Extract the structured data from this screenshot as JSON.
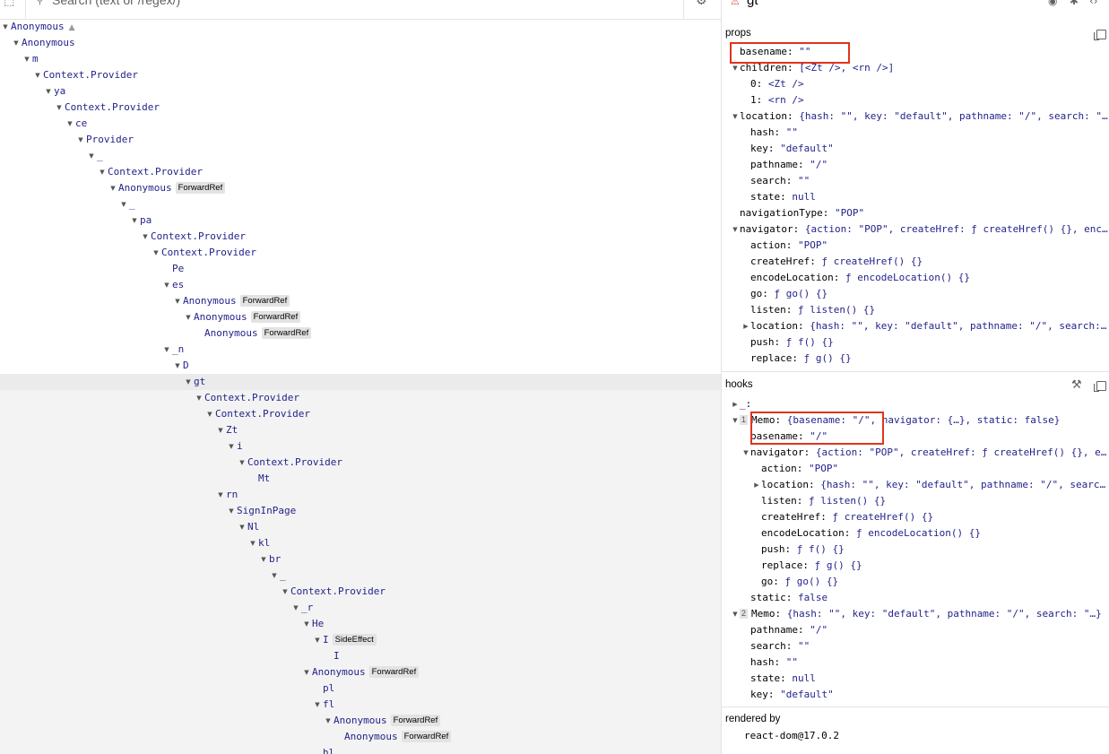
{
  "toolbar": {
    "search_placeholder": "Search (text or /regex/)"
  },
  "tree": [
    {
      "name": "Anonymous",
      "depth": 0,
      "warn": true
    },
    {
      "name": "Anonymous",
      "depth": 1
    },
    {
      "name": "m",
      "depth": 2
    },
    {
      "name": "Context.Provider",
      "depth": 3
    },
    {
      "name": "ya",
      "depth": 4
    },
    {
      "name": "Context.Provider",
      "depth": 5
    },
    {
      "name": "ce",
      "depth": 6
    },
    {
      "name": "Provider",
      "depth": 7
    },
    {
      "name": "_",
      "depth": 8
    },
    {
      "name": "Context.Provider",
      "depth": 9
    },
    {
      "name": "Anonymous",
      "depth": 10,
      "badge": "ForwardRef"
    },
    {
      "name": "_",
      "depth": 11
    },
    {
      "name": "pa",
      "depth": 12
    },
    {
      "name": "Context.Provider",
      "depth": 13
    },
    {
      "name": "Context.Provider",
      "depth": 14
    },
    {
      "name": "Pe",
      "depth": 15,
      "leaf": true
    },
    {
      "name": "es",
      "depth": 15
    },
    {
      "name": "Anonymous",
      "depth": 16,
      "badge": "ForwardRef"
    },
    {
      "name": "Anonymous",
      "depth": 17,
      "badge": "ForwardRef"
    },
    {
      "name": "Anonymous",
      "depth": 18,
      "badge": "ForwardRef",
      "leaf": true
    },
    {
      "name": "_n",
      "depth": 15
    },
    {
      "name": "D",
      "depth": 16
    },
    {
      "name": "gt",
      "depth": 17,
      "selected": true
    },
    {
      "name": "Context.Provider",
      "depth": 18
    },
    {
      "name": "Context.Provider",
      "depth": 19
    },
    {
      "name": "Zt",
      "depth": 20
    },
    {
      "name": "i",
      "depth": 21
    },
    {
      "name": "Context.Provider",
      "depth": 22
    },
    {
      "name": "Mt",
      "depth": 23,
      "leaf": true
    },
    {
      "name": "rn",
      "depth": 20
    },
    {
      "name": "SignInPage",
      "depth": 21
    },
    {
      "name": "Nl",
      "depth": 22
    },
    {
      "name": "kl",
      "depth": 23
    },
    {
      "name": "br",
      "depth": 24
    },
    {
      "name": "_",
      "depth": 25
    },
    {
      "name": "Context.Provider",
      "depth": 26
    },
    {
      "name": "_r",
      "depth": 27
    },
    {
      "name": "He",
      "depth": 28
    },
    {
      "name": "I",
      "depth": 29,
      "badge": "SideEffect"
    },
    {
      "name": "I",
      "depth": 30,
      "leaf": true
    },
    {
      "name": "Anonymous",
      "depth": 28,
      "badge": "ForwardRef"
    },
    {
      "name": "pl",
      "depth": 29,
      "leaf": true
    },
    {
      "name": "fl",
      "depth": 29
    },
    {
      "name": "Anonymous",
      "depth": 30,
      "badge": "ForwardRef"
    },
    {
      "name": "Anonymous",
      "depth": 31,
      "badge": "ForwardRef",
      "leaf": true
    },
    {
      "name": "hl",
      "depth": 29,
      "leaf": true
    }
  ],
  "inspector": {
    "component_name": "gt",
    "props_title": "props",
    "hooks_title": "hooks",
    "rendered_by_title": "rendered by",
    "rendered_by_value": "react-dom@17.0.2",
    "props": [
      {
        "indent": 0,
        "arrow": "none",
        "key": "basename",
        "value": "\"\""
      },
      {
        "indent": 0,
        "arrow": "down",
        "key": "children",
        "value": "[<Zt />, <rn />]"
      },
      {
        "indent": 1,
        "arrow": "none",
        "key": "0",
        "value": "<Zt />"
      },
      {
        "indent": 1,
        "arrow": "none",
        "key": "1",
        "value": "<rn />"
      },
      {
        "indent": 0,
        "arrow": "down",
        "key": "location",
        "value": "{hash: \"\", key: \"default\", pathname: \"/\", search: \"…"
      },
      {
        "indent": 1,
        "arrow": "none",
        "key": "hash",
        "value": "\"\""
      },
      {
        "indent": 1,
        "arrow": "none",
        "key": "key",
        "value": "\"default\""
      },
      {
        "indent": 1,
        "arrow": "none",
        "key": "pathname",
        "value": "\"/\""
      },
      {
        "indent": 1,
        "arrow": "none",
        "key": "search",
        "value": "\"\""
      },
      {
        "indent": 1,
        "arrow": "none",
        "key": "state",
        "value": "null"
      },
      {
        "indent": 0,
        "arrow": "none",
        "key": "navigationType",
        "value": "\"POP\""
      },
      {
        "indent": 0,
        "arrow": "down",
        "key": "navigator",
        "value": "{action: \"POP\", createHref: ƒ createHref() {}, enc…"
      },
      {
        "indent": 1,
        "arrow": "none",
        "key": "action",
        "value": "\"POP\""
      },
      {
        "indent": 1,
        "arrow": "none",
        "key": "createHref",
        "value": "ƒ createHref() {}"
      },
      {
        "indent": 1,
        "arrow": "none",
        "key": "encodeLocation",
        "value": "ƒ encodeLocation() {}"
      },
      {
        "indent": 1,
        "arrow": "none",
        "key": "go",
        "value": "ƒ go() {}"
      },
      {
        "indent": 1,
        "arrow": "none",
        "key": "listen",
        "value": "ƒ listen() {}"
      },
      {
        "indent": 1,
        "arrow": "right",
        "key": "location",
        "value": "{hash: \"\", key: \"default\", pathname: \"/\", search:…"
      },
      {
        "indent": 1,
        "arrow": "none",
        "key": "push",
        "value": "ƒ f() {}"
      },
      {
        "indent": 1,
        "arrow": "none",
        "key": "replace",
        "value": "ƒ g() {}"
      }
    ],
    "hooks": [
      {
        "indent": 0,
        "arrow": "right",
        "num": "",
        "key": "_",
        "value": ""
      },
      {
        "indent": 0,
        "arrow": "down",
        "num": "1",
        "key": "Memo",
        "value": "{basename: \"/\", navigator: {…}, static: false}"
      },
      {
        "indent": 1,
        "arrow": "none",
        "num": "",
        "key": "basename",
        "value": "\"/\""
      },
      {
        "indent": 1,
        "arrow": "down",
        "num": "",
        "key": "navigator",
        "value": "{action: \"POP\", createHref: ƒ createHref() {}, e…"
      },
      {
        "indent": 2,
        "arrow": "none",
        "num": "",
        "key": "action",
        "value": "\"POP\""
      },
      {
        "indent": 2,
        "arrow": "right",
        "num": "",
        "key": "location",
        "value": "{hash: \"\", key: \"default\", pathname: \"/\", searc…"
      },
      {
        "indent": 2,
        "arrow": "none",
        "num": "",
        "key": "listen",
        "value": "ƒ listen() {}"
      },
      {
        "indent": 2,
        "arrow": "none",
        "num": "",
        "key": "createHref",
        "value": "ƒ createHref() {}"
      },
      {
        "indent": 2,
        "arrow": "none",
        "num": "",
        "key": "encodeLocation",
        "value": "ƒ encodeLocation() {}"
      },
      {
        "indent": 2,
        "arrow": "none",
        "num": "",
        "key": "push",
        "value": "ƒ f() {}"
      },
      {
        "indent": 2,
        "arrow": "none",
        "num": "",
        "key": "replace",
        "value": "ƒ g() {}"
      },
      {
        "indent": 2,
        "arrow": "none",
        "num": "",
        "key": "go",
        "value": "ƒ go() {}"
      },
      {
        "indent": 1,
        "arrow": "none",
        "num": "",
        "key": "static",
        "value": "false"
      },
      {
        "indent": 0,
        "arrow": "down",
        "num": "2",
        "key": "Memo",
        "value": "{hash: \"\", key: \"default\", pathname: \"/\", search: \"…}"
      },
      {
        "indent": 1,
        "arrow": "none",
        "num": "",
        "key": "pathname",
        "value": "\"/\""
      },
      {
        "indent": 1,
        "arrow": "none",
        "num": "",
        "key": "search",
        "value": "\"\""
      },
      {
        "indent": 1,
        "arrow": "none",
        "num": "",
        "key": "hash",
        "value": "\"\""
      },
      {
        "indent": 1,
        "arrow": "none",
        "num": "",
        "key": "state",
        "value": "null"
      },
      {
        "indent": 1,
        "arrow": "none",
        "num": "",
        "key": "key",
        "value": "\"default\""
      }
    ]
  },
  "colors": {
    "highlight_box": "#e0341d",
    "component_name": "#23238c",
    "selected_row": "#ebebeb"
  }
}
